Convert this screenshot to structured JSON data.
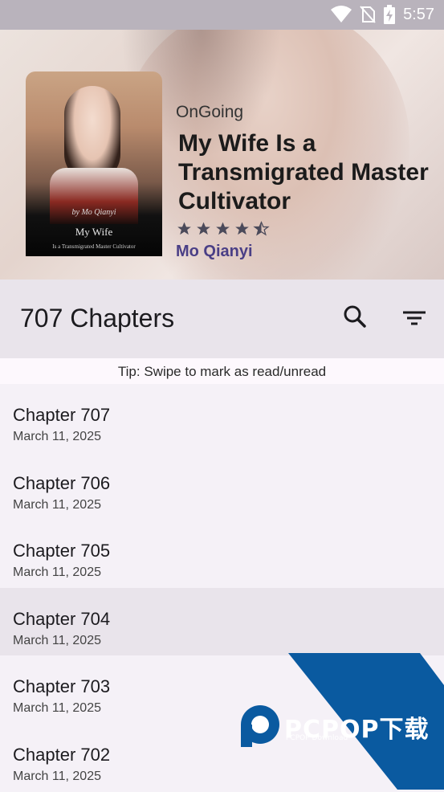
{
  "status_bar": {
    "time": "5:57"
  },
  "book": {
    "status": "OnGoing",
    "title": "My Wife Is a Transmigrated Master Cultivator",
    "rating_stars": 4.5,
    "author": "Mo Qianyi",
    "cover": {
      "author_line": "by Mo Qianyi",
      "title_line": "My Wife",
      "subtitle_line": "Is a Transmigrated Master Cultivator"
    }
  },
  "toolbar": {
    "chapter_count": "707 Chapters"
  },
  "tip": "Tip: Swipe to mark as read/unread",
  "chapters": [
    {
      "title": "Chapter 707",
      "date": "March 11, 2025"
    },
    {
      "title": "Chapter 706",
      "date": "March 11, 2025"
    },
    {
      "title": "Chapter 705",
      "date": "March 11, 2025"
    },
    {
      "title": "Chapter 704",
      "date": "March 11, 2025"
    },
    {
      "title": "Chapter 703",
      "date": "March 11, 2025"
    },
    {
      "title": "Chapter 702",
      "date": "March 11, 2025"
    }
  ],
  "watermark": {
    "brand": "PCPOP下载",
    "sub": "PCPOP Download"
  },
  "colors": {
    "accent": "#4a3f86",
    "toolbar_bg": "#e9e4eb",
    "watermark_blue": "#0a5aa0"
  }
}
